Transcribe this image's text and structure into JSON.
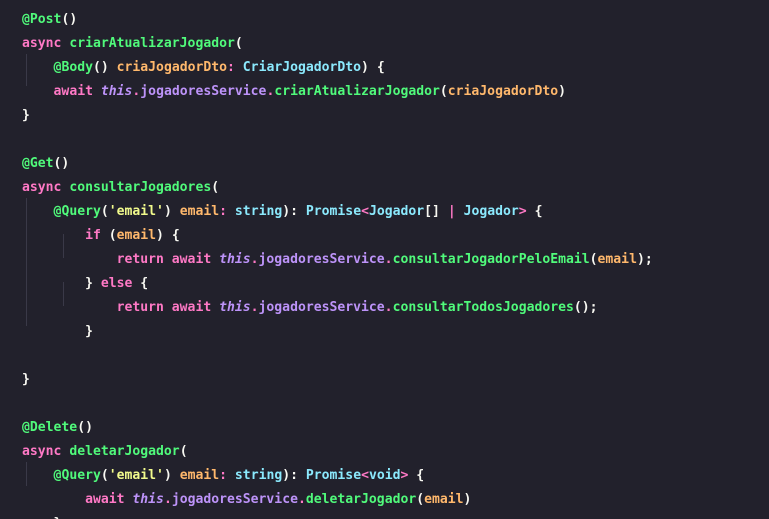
{
  "editor": {
    "lines": [
      [
        {
          "t": "@",
          "c": "dec"
        },
        {
          "t": "Post",
          "c": "dec"
        },
        {
          "t": "()",
          "c": "punc"
        }
      ],
      [
        {
          "t": "async ",
          "c": "kw"
        },
        {
          "t": "criarAtualizarJogador",
          "c": "fn"
        },
        {
          "t": "(",
          "c": "punc"
        }
      ],
      [
        {
          "t": "    "
        },
        {
          "t": "@",
          "c": "dec"
        },
        {
          "t": "Body",
          "c": "dec"
        },
        {
          "t": "() ",
          "c": "punc"
        },
        {
          "t": "criaJogadorDto",
          "c": "param"
        },
        {
          "t": ": ",
          "c": "kw"
        },
        {
          "t": "CriarJogadorDto",
          "c": "type"
        },
        {
          "t": ") {",
          "c": "punc"
        }
      ],
      [
        {
          "t": "    "
        },
        {
          "t": "await ",
          "c": "kw"
        },
        {
          "t": "this",
          "c": "this"
        },
        {
          "t": ".",
          "c": "kw"
        },
        {
          "t": "jogadoresService",
          "c": "prop"
        },
        {
          "t": ".",
          "c": "kw"
        },
        {
          "t": "criarAtualizarJogador",
          "c": "fn"
        },
        {
          "t": "(",
          "c": "punc"
        },
        {
          "t": "criaJogadorDto",
          "c": "param"
        },
        {
          "t": ")",
          "c": "punc"
        }
      ],
      [
        {
          "t": "}",
          "c": "punc"
        }
      ],
      [],
      [
        {
          "t": "@",
          "c": "dec"
        },
        {
          "t": "Get",
          "c": "dec"
        },
        {
          "t": "()",
          "c": "punc"
        }
      ],
      [
        {
          "t": "async ",
          "c": "kw"
        },
        {
          "t": "consultarJogadores",
          "c": "fn"
        },
        {
          "t": "(",
          "c": "punc"
        }
      ],
      [
        {
          "t": "    "
        },
        {
          "t": "@",
          "c": "dec"
        },
        {
          "t": "Query",
          "c": "dec"
        },
        {
          "t": "(",
          "c": "punc"
        },
        {
          "t": "'email'",
          "c": "str"
        },
        {
          "t": ") ",
          "c": "punc"
        },
        {
          "t": "email",
          "c": "param"
        },
        {
          "t": ": ",
          "c": "kw"
        },
        {
          "t": "string",
          "c": "type"
        },
        {
          "t": "): ",
          "c": "punc"
        },
        {
          "t": "Promise",
          "c": "type"
        },
        {
          "t": "<",
          "c": "kw"
        },
        {
          "t": "Jogador",
          "c": "type"
        },
        {
          "t": "[] ",
          "c": "punc"
        },
        {
          "t": "| ",
          "c": "kw"
        },
        {
          "t": "Jogador",
          "c": "type"
        },
        {
          "t": "> ",
          "c": "kw"
        },
        {
          "t": "{",
          "c": "punc"
        }
      ],
      [
        {
          "t": "        "
        },
        {
          "t": "if ",
          "c": "kw"
        },
        {
          "t": "(",
          "c": "punc"
        },
        {
          "t": "email",
          "c": "param"
        },
        {
          "t": ") {",
          "c": "punc"
        }
      ],
      [
        {
          "t": "            "
        },
        {
          "t": "return await ",
          "c": "kw"
        },
        {
          "t": "this",
          "c": "this"
        },
        {
          "t": ".",
          "c": "kw"
        },
        {
          "t": "jogadoresService",
          "c": "prop"
        },
        {
          "t": ".",
          "c": "kw"
        },
        {
          "t": "consultarJogadorPeloEmail",
          "c": "fn"
        },
        {
          "t": "(",
          "c": "punc"
        },
        {
          "t": "email",
          "c": "param"
        },
        {
          "t": ");",
          "c": "punc"
        }
      ],
      [
        {
          "t": "        "
        },
        {
          "t": "} ",
          "c": "punc"
        },
        {
          "t": "else ",
          "c": "kw"
        },
        {
          "t": "{",
          "c": "punc"
        }
      ],
      [
        {
          "t": "            "
        },
        {
          "t": "return await ",
          "c": "kw"
        },
        {
          "t": "this",
          "c": "this"
        },
        {
          "t": ".",
          "c": "kw"
        },
        {
          "t": "jogadoresService",
          "c": "prop"
        },
        {
          "t": ".",
          "c": "kw"
        },
        {
          "t": "consultarTodosJogadores",
          "c": "fn"
        },
        {
          "t": "();",
          "c": "punc"
        }
      ],
      [
        {
          "t": "        "
        },
        {
          "t": "}",
          "c": "punc"
        }
      ],
      [],
      [
        {
          "t": "}",
          "c": "punc"
        }
      ],
      [],
      [
        {
          "t": "@",
          "c": "dec"
        },
        {
          "t": "Delete",
          "c": "dec"
        },
        {
          "t": "()",
          "c": "punc"
        }
      ],
      [
        {
          "t": "async ",
          "c": "kw"
        },
        {
          "t": "deletarJogador",
          "c": "fn"
        },
        {
          "t": "(",
          "c": "punc"
        }
      ],
      [
        {
          "t": "    "
        },
        {
          "t": "@",
          "c": "dec"
        },
        {
          "t": "Query",
          "c": "dec"
        },
        {
          "t": "(",
          "c": "punc"
        },
        {
          "t": "'email'",
          "c": "str"
        },
        {
          "t": ") ",
          "c": "punc"
        },
        {
          "t": "email",
          "c": "param"
        },
        {
          "t": ": ",
          "c": "kw"
        },
        {
          "t": "string",
          "c": "type"
        },
        {
          "t": "): ",
          "c": "punc"
        },
        {
          "t": "Promise",
          "c": "type"
        },
        {
          "t": "<",
          "c": "kw"
        },
        {
          "t": "void",
          "c": "type"
        },
        {
          "t": "> ",
          "c": "kw"
        },
        {
          "t": "{",
          "c": "punc"
        }
      ],
      [
        {
          "t": "        "
        },
        {
          "t": "await ",
          "c": "kw"
        },
        {
          "t": "this",
          "c": "this"
        },
        {
          "t": ".",
          "c": "kw"
        },
        {
          "t": "jogadoresService",
          "c": "prop"
        },
        {
          "t": ".",
          "c": "kw"
        },
        {
          "t": "deletarJogador",
          "c": "fn"
        },
        {
          "t": "(",
          "c": "punc"
        },
        {
          "t": "email",
          "c": "param"
        },
        {
          "t": ")",
          "c": "punc"
        }
      ],
      [
        {
          "t": "    "
        },
        {
          "t": "}",
          "c": "punc"
        }
      ]
    ]
  }
}
